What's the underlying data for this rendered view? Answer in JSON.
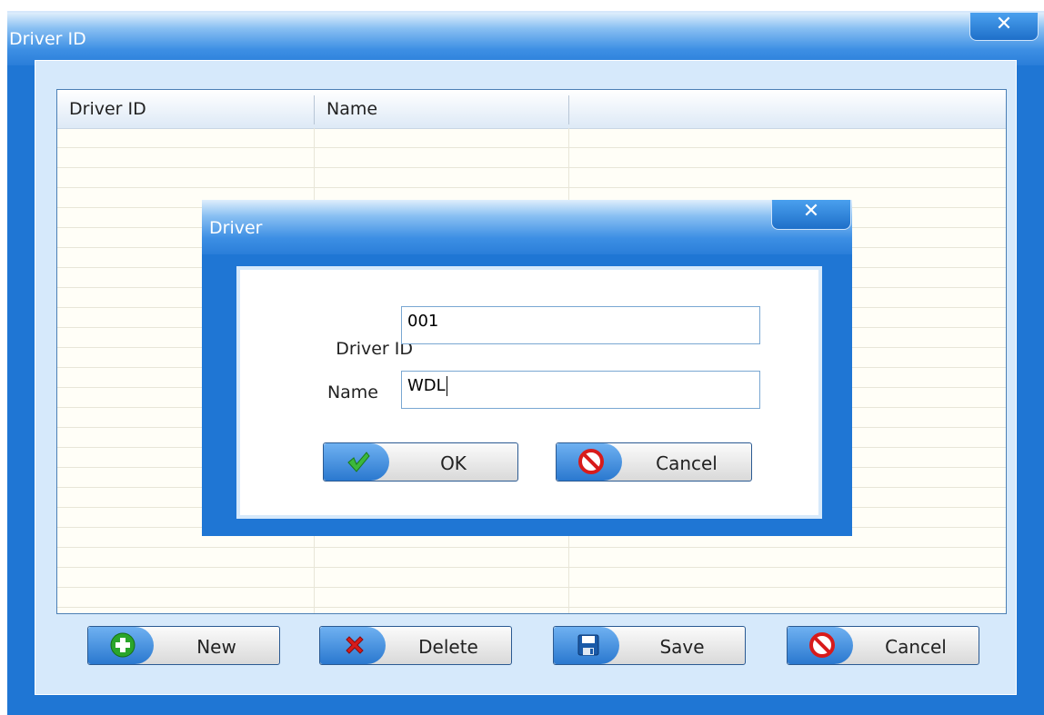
{
  "window": {
    "title": "Driver ID",
    "close_glyph": "✕"
  },
  "grid": {
    "columns": [
      "Driver ID",
      "Name",
      ""
    ]
  },
  "toolbar": {
    "new_label": "New",
    "delete_label": "Delete",
    "save_label": "Save",
    "cancel_label": "Cancel"
  },
  "dialog": {
    "title": "Driver",
    "close_glyph": "✕",
    "driver_id_label": "Driver ID",
    "driver_id_value": "001",
    "name_label": "Name",
    "name_value": "WDL",
    "ok_label": "OK",
    "cancel_label": "Cancel"
  },
  "icons": {
    "new": "plus-circle-icon",
    "delete": "red-x-icon",
    "save": "floppy-disk-icon",
    "cancel": "no-entry-icon",
    "ok": "checkmark-icon"
  },
  "colors": {
    "window_blue": "#1f76d4",
    "light_blue": "#d6e9fb",
    "green": "#2aa52a",
    "red": "#d81b1b"
  }
}
